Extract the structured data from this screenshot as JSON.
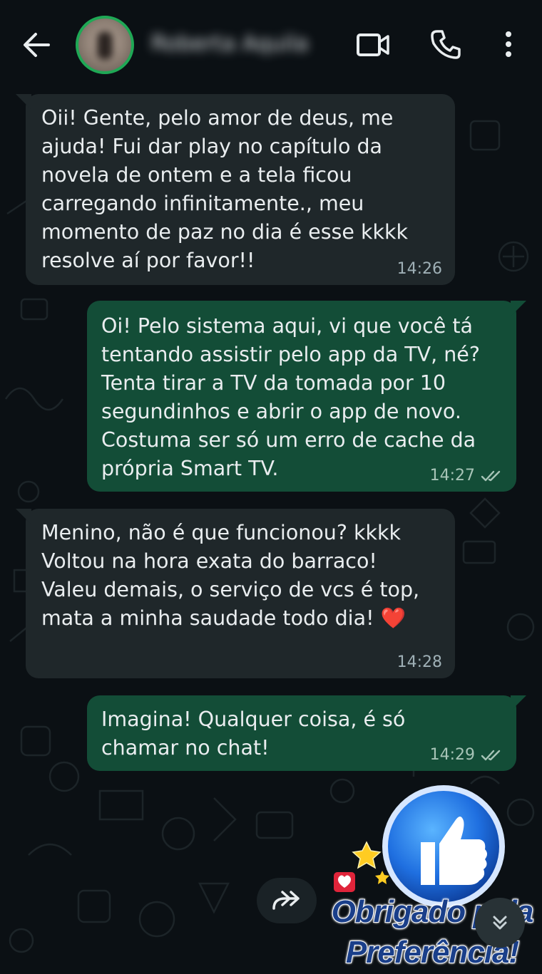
{
  "header": {
    "contact_name": "Roberta Aquila",
    "icons": [
      "arrow-left-icon",
      "video-camera-icon",
      "phone-icon",
      "more-vertical-icon"
    ]
  },
  "messages": [
    {
      "direction": "incoming",
      "text": "Oii! Gente, pelo amor de deus, me\najuda! Fui dar play no capítulo da\nnovela de ontem e a tela ficou\ncarregando infinitamente., meu\nmomento de paz no dia é esse kkkk\nresolve aí por favor!!",
      "time": "14:26"
    },
    {
      "direction": "outgoing",
      "text": "Oi! Pelo sistema aqui, vi que você tá\ntentando assistir pelo app da TV, né?\nTenta tirar a TV da tomada por 10\nsegundinhos e abrir o app de novo.\nCostuma ser só um erro de cache da\nprópria Smart TV.",
      "time": "14:27",
      "status": "read"
    },
    {
      "direction": "incoming",
      "text": "Menino, não é que funcionou? kkkk\nVoltou na hora exata do barraco!\nValeu demais, o serviço de vcs é top,\nmata a minha saudade todo dia! ❤️",
      "time": "14:28"
    },
    {
      "direction": "outgoing",
      "text": "Imagina! Qualquer coisa, é só\nchamar no chat!",
      "time": "14:29",
      "status": "read"
    }
  ],
  "sticker": {
    "line1": "Obrigado pela",
    "line2": "Preferência!"
  },
  "colors": {
    "incoming_bubble": "#1f272a",
    "outgoing_bubble": "#134d37",
    "accent": "#1fa855",
    "read_ticks": "#a7c4b7"
  }
}
